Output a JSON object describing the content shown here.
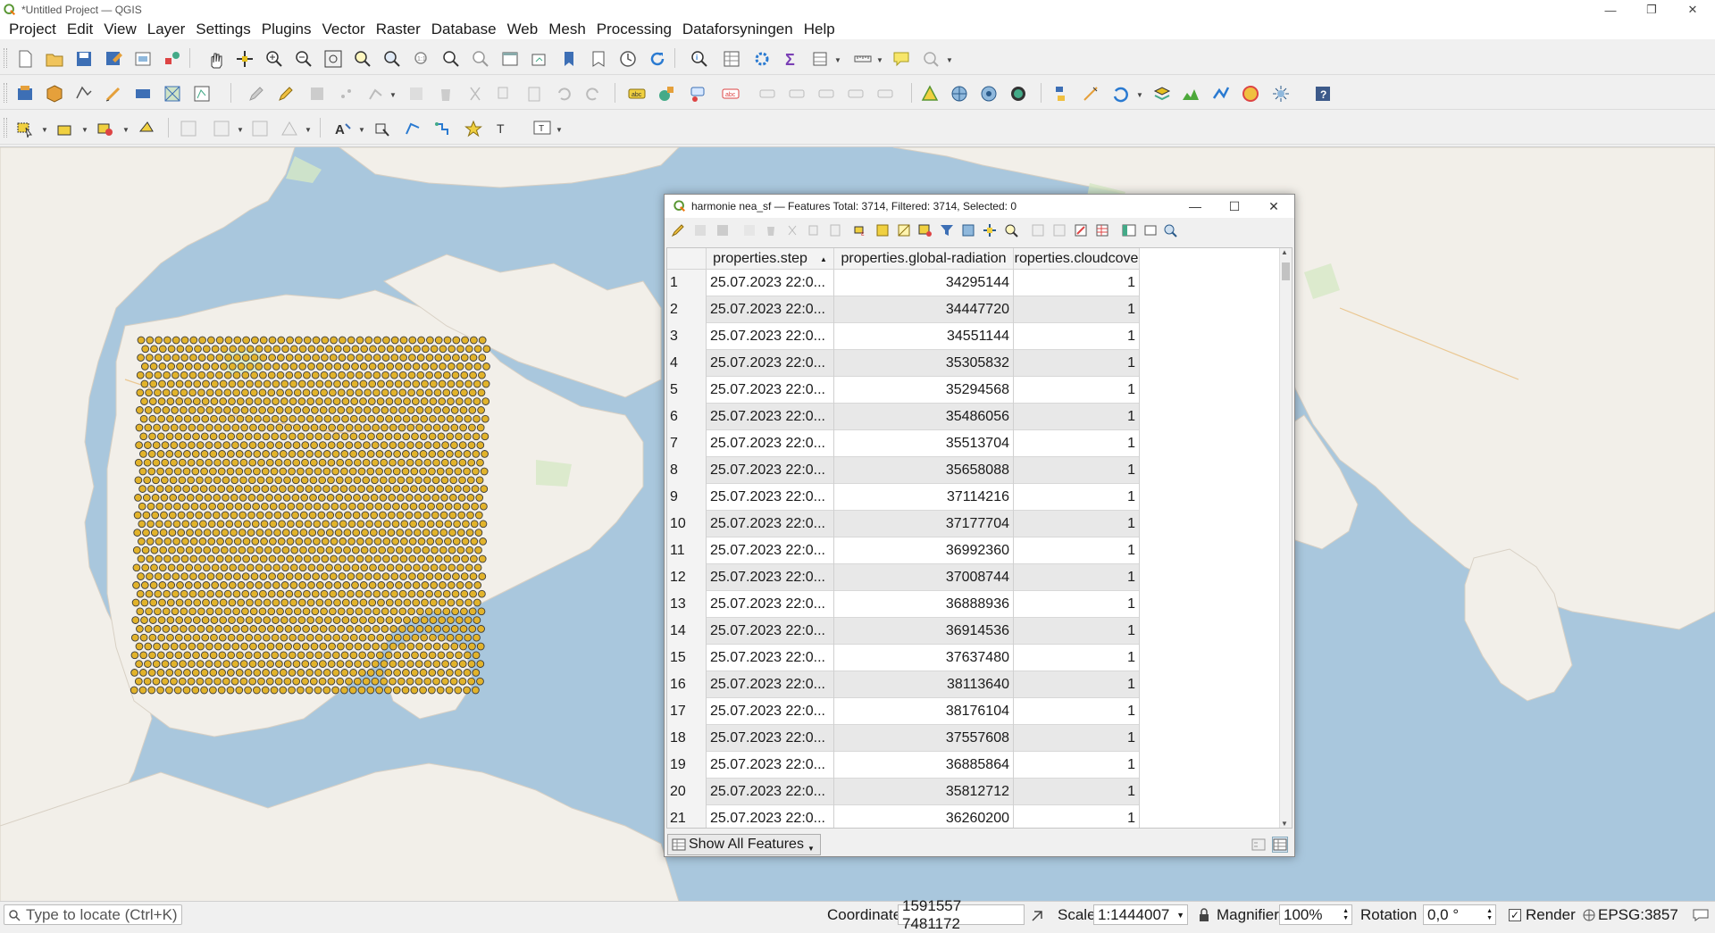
{
  "window": {
    "title": "*Untitled Project — QGIS"
  },
  "menu": [
    "Project",
    "Edit",
    "View",
    "Layer",
    "Settings",
    "Plugins",
    "Vector",
    "Raster",
    "Database",
    "Web",
    "Mesh",
    "Processing",
    "Dataforsyningen",
    "Help"
  ],
  "attribute_table": {
    "title": "harmonie nea_sf — Features Total: 3714, Filtered: 3714, Selected: 0",
    "columns": [
      "properties.step",
      "properties.global-radiation",
      "roperties.cloudcove"
    ],
    "sort_indicator": "▲",
    "rows": [
      {
        "id": "1",
        "step": "25.07.2023 22:0...",
        "radiation": "34295144",
        "cloud": "1"
      },
      {
        "id": "2",
        "step": "25.07.2023 22:0...",
        "radiation": "34447720",
        "cloud": "1"
      },
      {
        "id": "3",
        "step": "25.07.2023 22:0...",
        "radiation": "34551144",
        "cloud": "1"
      },
      {
        "id": "4",
        "step": "25.07.2023 22:0...",
        "radiation": "35305832",
        "cloud": "1"
      },
      {
        "id": "5",
        "step": "25.07.2023 22:0...",
        "radiation": "35294568",
        "cloud": "1"
      },
      {
        "id": "6",
        "step": "25.07.2023 22:0...",
        "radiation": "35486056",
        "cloud": "1"
      },
      {
        "id": "7",
        "step": "25.07.2023 22:0...",
        "radiation": "35513704",
        "cloud": "1"
      },
      {
        "id": "8",
        "step": "25.07.2023 22:0...",
        "radiation": "35658088",
        "cloud": "1"
      },
      {
        "id": "9",
        "step": "25.07.2023 22:0...",
        "radiation": "37114216",
        "cloud": "1"
      },
      {
        "id": "10",
        "step": "25.07.2023 22:0...",
        "radiation": "37177704",
        "cloud": "1"
      },
      {
        "id": "11",
        "step": "25.07.2023 22:0...",
        "radiation": "36992360",
        "cloud": "1"
      },
      {
        "id": "12",
        "step": "25.07.2023 22:0...",
        "radiation": "37008744",
        "cloud": "1"
      },
      {
        "id": "13",
        "step": "25.07.2023 22:0...",
        "radiation": "36888936",
        "cloud": "1"
      },
      {
        "id": "14",
        "step": "25.07.2023 22:0...",
        "radiation": "36914536",
        "cloud": "1"
      },
      {
        "id": "15",
        "step": "25.07.2023 22:0...",
        "radiation": "37637480",
        "cloud": "1"
      },
      {
        "id": "16",
        "step": "25.07.2023 22:0...",
        "radiation": "38113640",
        "cloud": "1"
      },
      {
        "id": "17",
        "step": "25.07.2023 22:0...",
        "radiation": "38176104",
        "cloud": "1"
      },
      {
        "id": "18",
        "step": "25.07.2023 22:0...",
        "radiation": "37557608",
        "cloud": "1"
      },
      {
        "id": "19",
        "step": "25.07.2023 22:0...",
        "radiation": "36885864",
        "cloud": "1"
      },
      {
        "id": "20",
        "step": "25.07.2023 22:0...",
        "radiation": "35812712",
        "cloud": "1"
      },
      {
        "id": "21",
        "step": "25.07.2023 22:0...",
        "radiation": "36260200",
        "cloud": "1"
      }
    ],
    "show_all_label": "Show All Features"
  },
  "statusbar": {
    "locate_placeholder": "Type to locate (Ctrl+K)",
    "coordinate_label": "Coordinate",
    "coordinate_value": "1591557 7481172",
    "scale_label": "Scale",
    "scale_value": "1:1444007",
    "magnifier_label": "Magnifier",
    "magnifier_value": "100%",
    "rotation_label": "Rotation",
    "rotation_value": "0,0 °",
    "render_label": "Render",
    "crs_label": "EPSG:3857"
  },
  "colors": {
    "water": "#a9c7dd",
    "land": "#f2efe9",
    "point_fill": "#e2b32b",
    "point_stroke": "#3a3a3a",
    "accent": "#589632"
  }
}
